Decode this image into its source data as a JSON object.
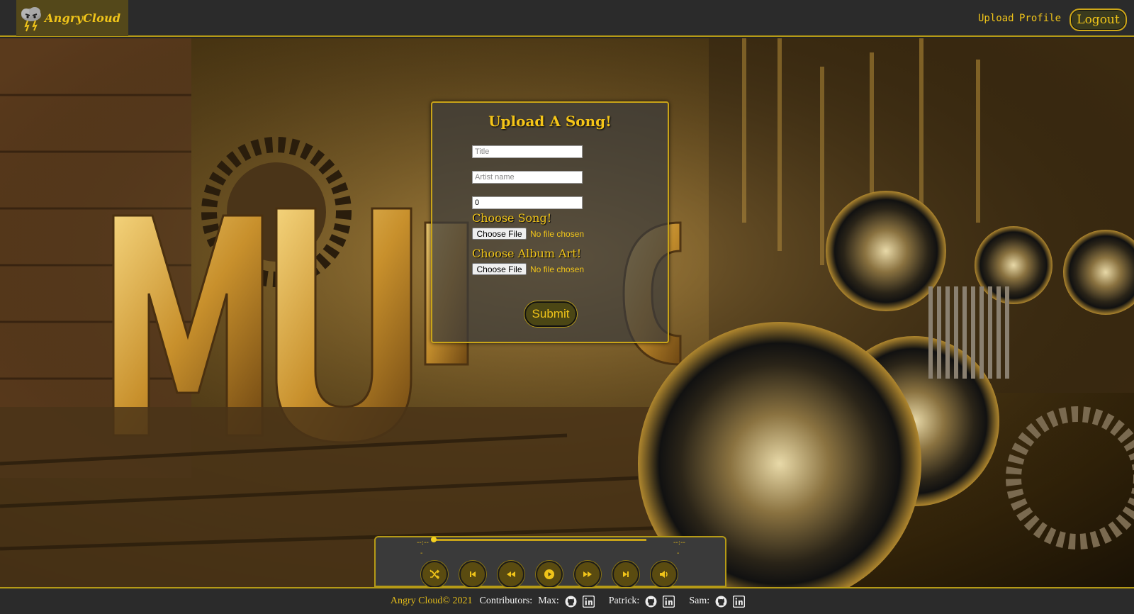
{
  "navbar": {
    "brand_name": "AngryCloud",
    "upload_link": "Upload",
    "profile_link": "Profile",
    "logout_label": "Logout",
    "accent_color": "#f0c419"
  },
  "upload_form": {
    "title": "Upload A Song!",
    "title_placeholder": "Title",
    "artist_placeholder": "Artist name",
    "number_value": "0",
    "song_label": "Choose Song!",
    "album_art_label": "Choose Album Art!",
    "choose_file_label": "Choose File",
    "no_file_text": "No file chosen",
    "submit_label": "Submit"
  },
  "player": {
    "current_time": "--:--",
    "duration": "--:--",
    "progress": 0,
    "controls": [
      "shuffle-icon",
      "previous-icon",
      "rewind-icon",
      "play-icon",
      "fast-forward-icon",
      "next-icon",
      "volume-icon"
    ]
  },
  "footer": {
    "copyright": "Angry Cloud© 2021",
    "contributors_label": "Contributors:",
    "contributors": [
      {
        "name": "Max:",
        "icons": [
          "github-icon",
          "linkedin-icon"
        ]
      },
      {
        "name": "Patrick:",
        "icons": [
          "github-icon",
          "linkedin-icon"
        ]
      },
      {
        "name": "Sam:",
        "icons": [
          "github-icon",
          "linkedin-icon"
        ]
      }
    ]
  },
  "background": {
    "word": "MUSIC"
  }
}
